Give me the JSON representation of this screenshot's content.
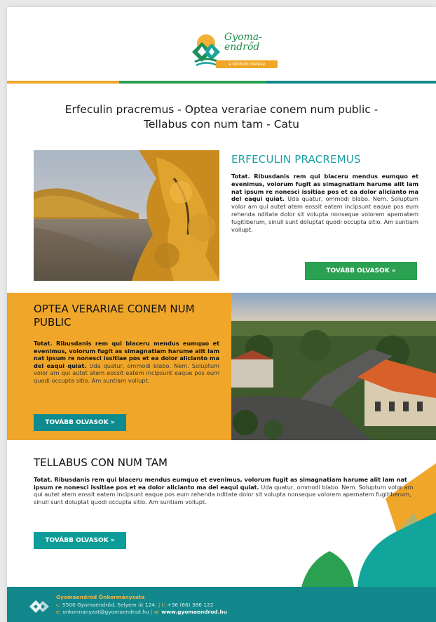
{
  "header": {
    "logo_script": "Gyoma-endrőd",
    "logo_tagline": "a Körösök ölelése"
  },
  "main_title": "Erfeculin pracremus - Optea verariae conem num public - Tellabus con num tam - Catu",
  "articles": [
    {
      "title": "ERFECULIN PRACREMUS",
      "lead": "Totat. Ribusdanis rem qui blaceru mendus eumquo et evenimus, volorum fugit as simagnatiam harume alit lam nat ipsum re nonesci issitiae pos et ea dolor alicianto ma del eaqui quiat.",
      "body": "Uda quatur, ommodi blabo. Nem. Soluptum volor am qui autet atem eossit eatem incipsunt eaque pos eum rehenda nditate dolor sit volupta nonseque volorem apernatem fugitiberum, sinull sunt doluptat quodi occupta sitio. Am suntiam vollupt.",
      "button": "TOVÁBB OLVASOK »"
    },
    {
      "title": "OPTEA VERARIAE CONEM NUM PUBLIC",
      "lead": "Totat. Ribusdanis rem qui blaceru mendus eumquo et evenimus, volorum fugit as simagnatiam harume alit lam nat ipsum re nonesci issitiae pos et ea dolor alicianto ma del eaqui quiat.",
      "body": "Uda quatur, ommodi blabo. Nem. Soluptum volor am qui autet atem eossit eatem incipsunt eaque pos eum quodi occupta sitio. Am suntiam vollupt.",
      "button": "TOVÁBB OLVASOK »"
    },
    {
      "title": "TELLABUS CON NUM TAM",
      "lead": "Totat. Ribusdanis rem qui blaceru mendus eumquo et evenimus, volorum fugit as simagnatiam harume alit lam nat ipsum re nonesci issitiae pos et ea dolor alicianto ma del eaqui quiat.",
      "body": "Uda quatur, ommodi blabo. Nem. Soluptum volor am qui autet atem eossit eatem incipsunt eaque pos eum rehenda nditate dolor sit volupta nonseque volorem apernatem fugitiberum, sinull sunt doluptat quodi occupta sitio. Am suntiam vollupt.",
      "button": "TOVÁBB OLVASOK »"
    }
  ],
  "footer": {
    "org": "Gyomaendrőd Önkormányzata",
    "address_prefix": "c:",
    "address": "5500 Gyomaendrőd, Selyem út 124.",
    "phone_prefix": "| t:",
    "phone": "+36 (66) 386 122",
    "email_prefix": "e:",
    "email": "onkormanyzat@gyomaendrod.hu",
    "web_prefix": "| w:",
    "web": "www.gyomaendrod.hu"
  },
  "colors": {
    "teal": "#12878c",
    "green": "#2aa051",
    "orange": "#f0a629",
    "title_teal": "#1aa0a3"
  },
  "icons": [
    "logo-emblem-icon",
    "footer-logo-icon"
  ]
}
